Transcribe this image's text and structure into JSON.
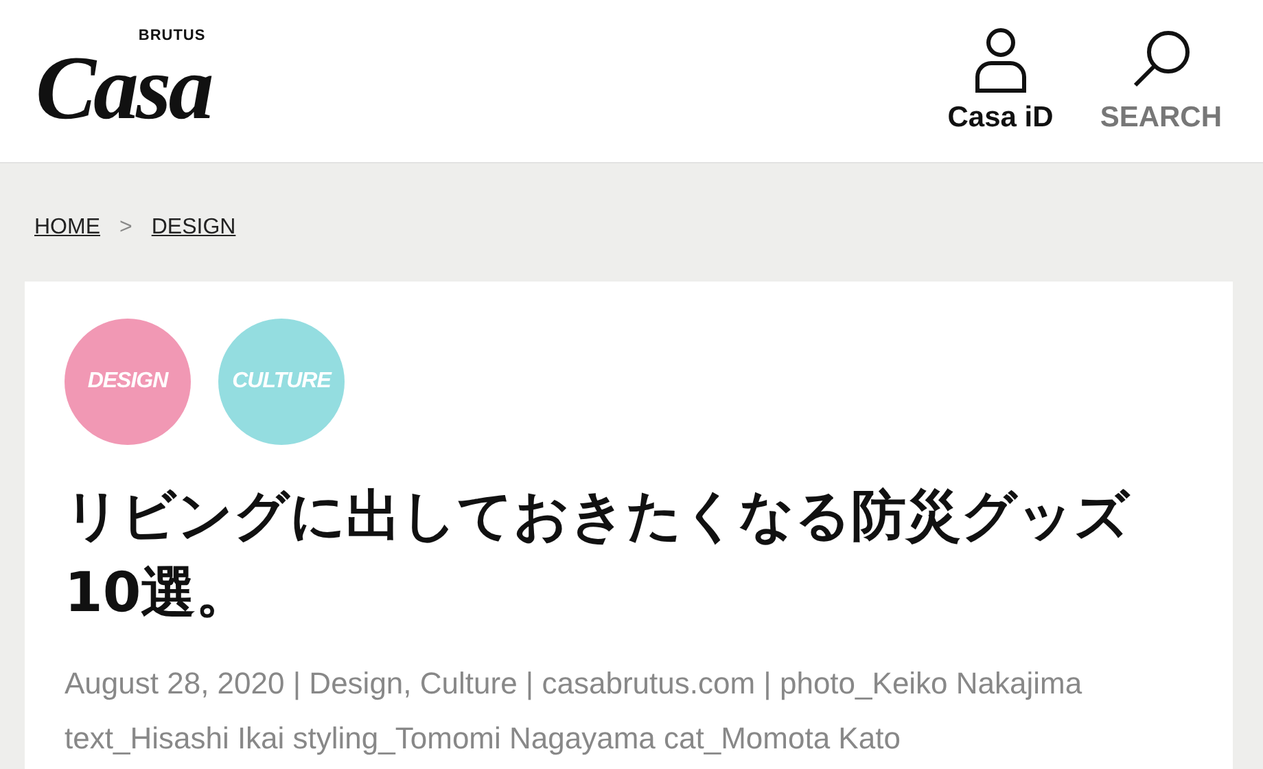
{
  "header": {
    "logo": {
      "small": "BRUTUS",
      "main": "Casa"
    },
    "actions": [
      {
        "kind": "account",
        "label": "Casa iD"
      },
      {
        "kind": "search",
        "label": "SEARCH"
      }
    ]
  },
  "breadcrumb": {
    "items": [
      "HOME",
      "DESIGN"
    ],
    "separator": ">"
  },
  "article": {
    "categories": [
      {
        "label": "DESIGN",
        "color": "#f198b4"
      },
      {
        "label": "CULTURE",
        "color": "#94dde0"
      }
    ],
    "title": "リビングに出しておきたくなる防災グッズ10選。",
    "meta": "August 28, 2020 | Design, Culture | casabrutus.com | photo_Keiko Nakajima   text_Hisashi Ikai   styling_Tomomi Nagayama cat_Momota Kato"
  }
}
